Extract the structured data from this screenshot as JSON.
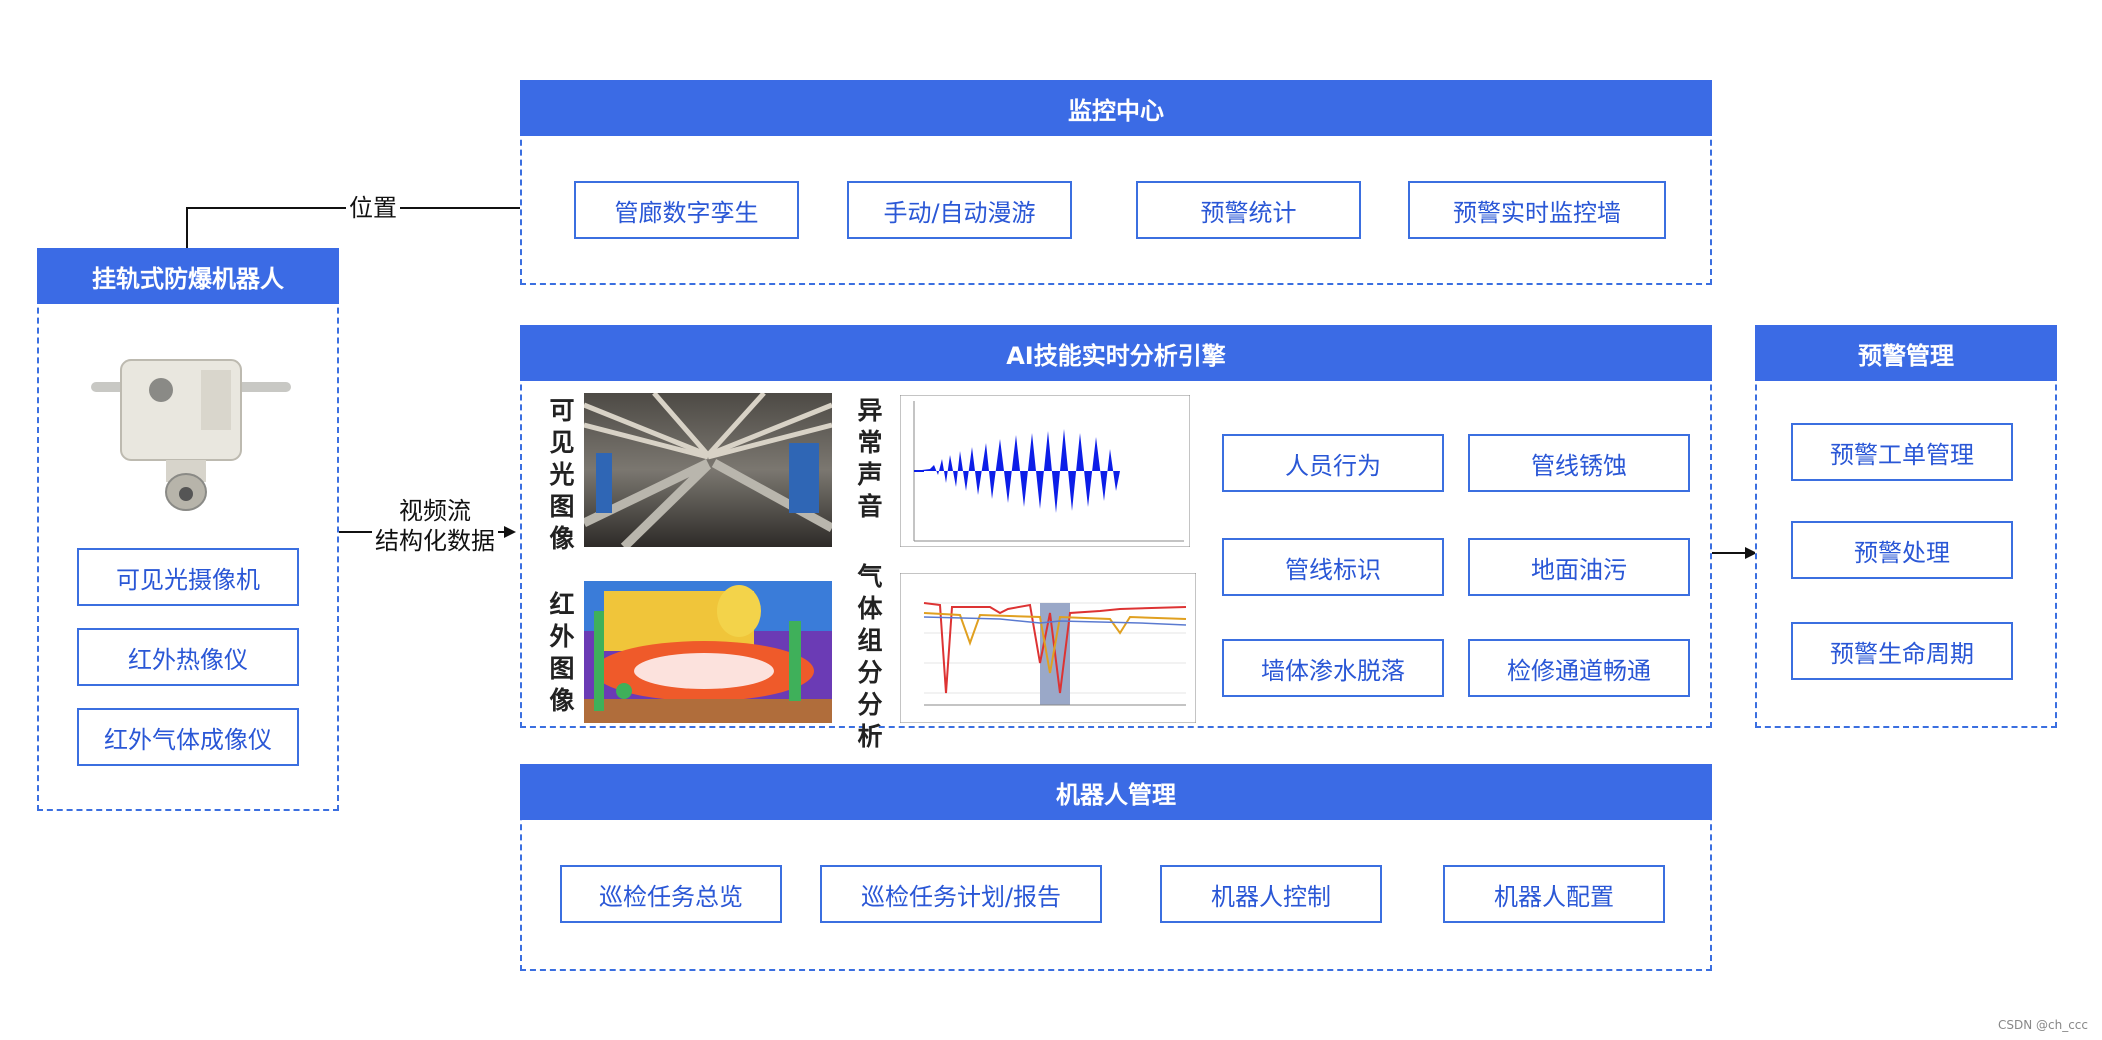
{
  "robot": {
    "title": "挂轨式防爆机器人",
    "devices": [
      "可见光摄像机",
      "红外热像仪",
      "红外气体成像仪"
    ]
  },
  "monitoring": {
    "title": "监控中心",
    "items": [
      "管廊数字孪生",
      "手动/自动漫游",
      "预警统计",
      "预警实时监控墙"
    ]
  },
  "ai_engine": {
    "title": "AI技能实时分析引擎",
    "image_labels": [
      "可见光图像",
      "红外图像",
      "异常声音",
      "气体组分分析"
    ],
    "skills": [
      "人员行为",
      "管线锈蚀",
      "管线标识",
      "地面油污",
      "墙体渗水脱落",
      "检修通道畅通"
    ]
  },
  "alert": {
    "title": "预警管理",
    "items": [
      "预警工单管理",
      "预警处理",
      "预警生命周期"
    ]
  },
  "robot_mgmt": {
    "title": "机器人管理",
    "items": [
      "巡检任务总览",
      "巡检任务计划/报告",
      "机器人控制",
      "机器人配置"
    ]
  },
  "connectors": {
    "position": "位置",
    "stream_line1": "视频流",
    "stream_line2": "结构化数据"
  },
  "watermark": "CSDN @ch_ccc",
  "colors": {
    "primary": "#3b6be5",
    "button_text": "#2a57d6"
  }
}
